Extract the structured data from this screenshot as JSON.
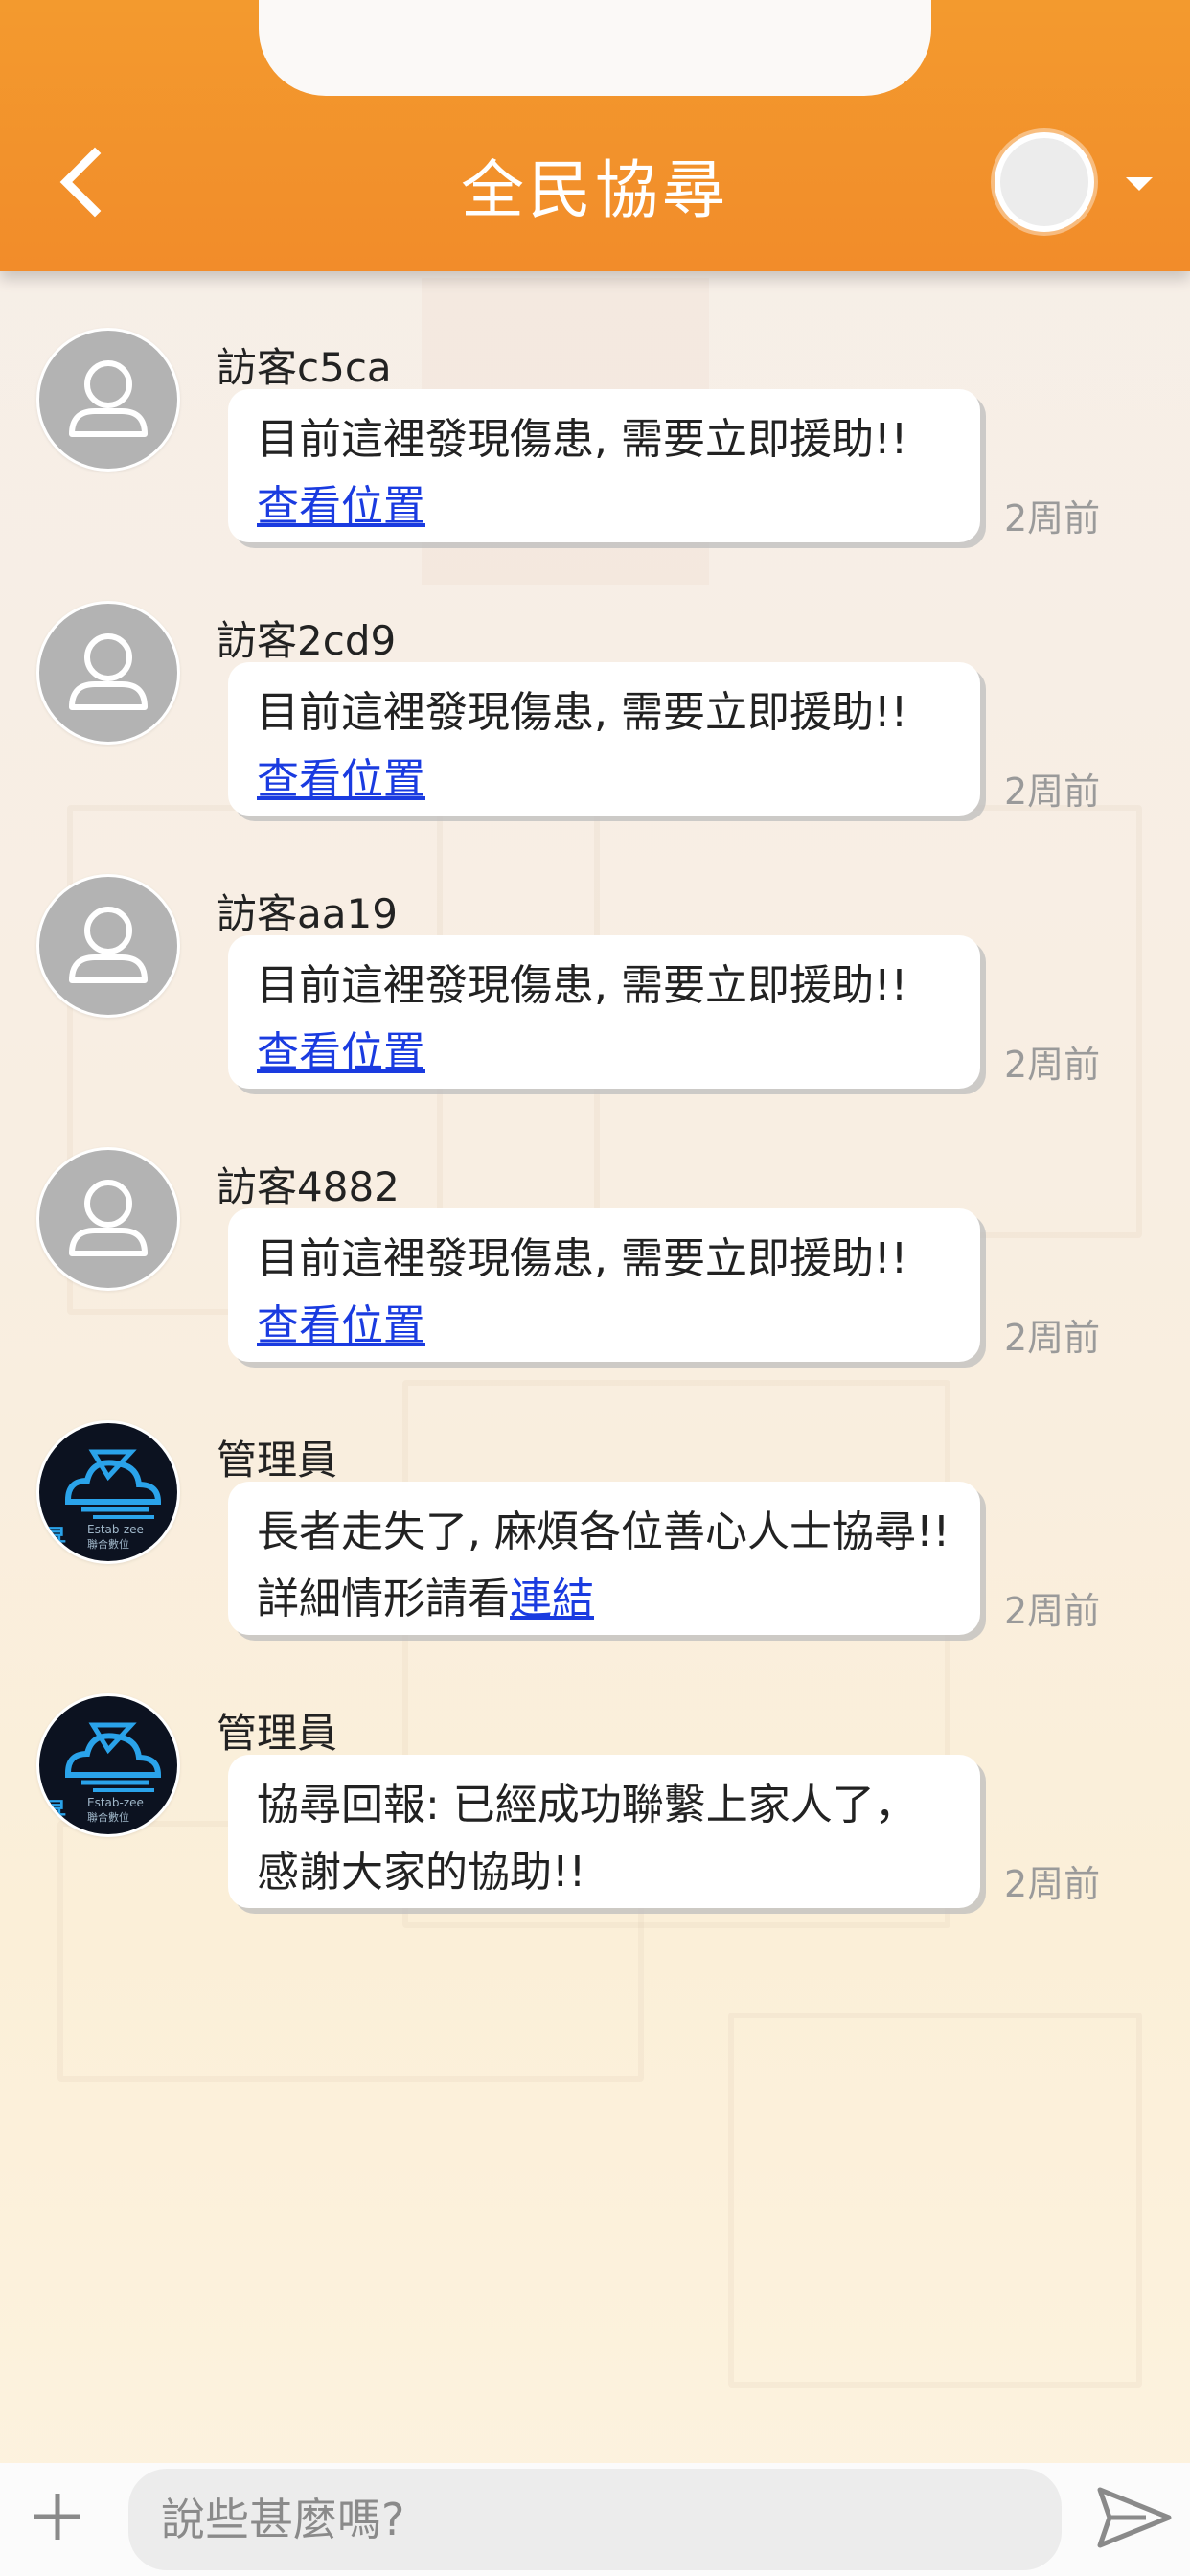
{
  "header": {
    "title": "全民協尋",
    "back_icon": "chevron-left-icon",
    "accent_color": "#f28c2a"
  },
  "messages": [
    {
      "name": "訪客c5ca",
      "text": "目前這裡發現傷患, 需要立即援助!! ",
      "link": "查看位置",
      "time": "2周前",
      "role": "guest"
    },
    {
      "name": "訪客2cd9",
      "text": "目前這裡發現傷患, 需要立即援助!! ",
      "link": "查看位置",
      "time": "2周前",
      "role": "guest"
    },
    {
      "name": "訪客aa19",
      "text": "目前這裡發現傷患, 需要立即援助!! ",
      "link": "查看位置",
      "time": "2周前",
      "role": "guest"
    },
    {
      "name": "訪客4882",
      "text": "目前這裡發現傷患, 需要立即援助!! ",
      "link": "查看位置",
      "time": "2周前",
      "role": "guest"
    },
    {
      "name": "管理員",
      "text": "長者走失了, 麻煩各位善心人士協尋!! 詳細情形請看",
      "link": "連結",
      "time": "2周前",
      "role": "admin"
    },
    {
      "name": "管理員",
      "text": "協尋回報: 已經成功聯繫上家人了，感謝大家的協助!!",
      "link": "",
      "time": "2周前",
      "role": "admin"
    }
  ],
  "admin_logo_text": {
    "brand": "Estab-zee",
    "sub": "聯合數位",
    "mark": "昇"
  },
  "input": {
    "placeholder": "說些甚麼嗎?",
    "add_icon": "plus-icon",
    "send_icon": "send-icon"
  }
}
